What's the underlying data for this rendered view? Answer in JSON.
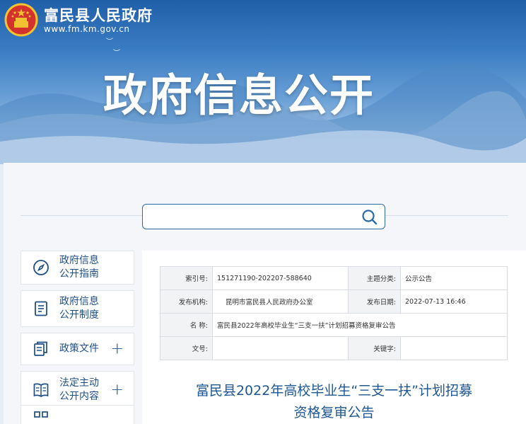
{
  "header": {
    "site_name": "富民县人民政府",
    "site_url": "www.fm.km.gov.cn",
    "banner_title": "政府信息公开"
  },
  "search": {
    "placeholder": ""
  },
  "sidebar": {
    "items": [
      {
        "label": "政府信息\n公开指南",
        "icon": "compass-icon",
        "expandable": false
      },
      {
        "label": "政府信息\n公开制度",
        "icon": "document-icon",
        "expandable": false
      },
      {
        "label": "政策文件",
        "icon": "files-icon",
        "expandable": true
      },
      {
        "label": "法定主动\n公开内容",
        "icon": "book-icon",
        "expandable": true
      }
    ]
  },
  "meta": {
    "index_label": "索引号:",
    "index_value": "151271190-202207-588640",
    "category_label": "主题分类:",
    "category_value": "公示公告",
    "publisher_label": "发布机构:",
    "publisher_value": "昆明市富民县人民政府办公室",
    "date_label": "发布日期:",
    "date_value": "2022-07-13 16:46",
    "name_label": "名 称:",
    "name_value": "富民县2022年高校毕业生“三支一扶”计划招募资格复审公告",
    "docno_label": "文号:",
    "docno_value": "",
    "keyword_label": "关键字:",
    "keyword_value": ""
  },
  "article": {
    "title_line1": "富民县2022年高校毕业生“三支一扶”计划招募",
    "title_line2": "资格复审公告"
  },
  "colors": {
    "brand": "#1e4f86",
    "accent": "#2a6aa8"
  }
}
